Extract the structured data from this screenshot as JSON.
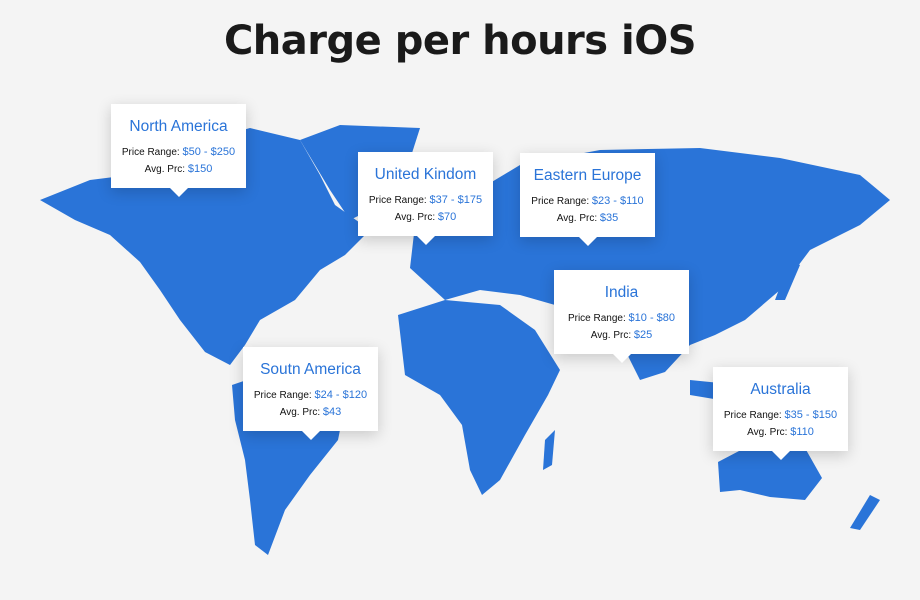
{
  "title": "Charge per hours iOS",
  "colors": {
    "map": "#2a74d8",
    "accent": "#2a74d8",
    "background": "#f4f4f4"
  },
  "labels": {
    "price_range": "Price Range:",
    "avg": "Avg. Prc:"
  },
  "regions": [
    {
      "name": "North America",
      "range": "$50 - $250",
      "avg": "$150"
    },
    {
      "name": "United Kindom",
      "range": "$37 - $175",
      "avg": "$70"
    },
    {
      "name": "Eastern Europe",
      "range": "$23 - $110",
      "avg": "$35"
    },
    {
      "name": "India",
      "range": "$10 - $80",
      "avg": "$25"
    },
    {
      "name": "Soutn America",
      "range": "$24 - $120",
      "avg": "$43"
    },
    {
      "name": "Australia",
      "range": "$35 - $150",
      "avg": "$110"
    }
  ]
}
